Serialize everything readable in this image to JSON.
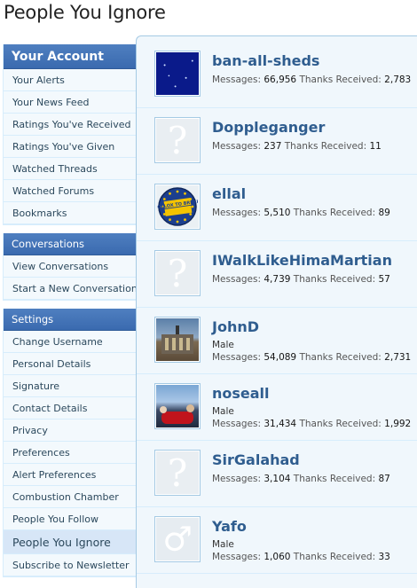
{
  "page": {
    "title": "People You Ignore"
  },
  "sidebar": {
    "sections": [
      {
        "heading": "Your Account",
        "items": [
          "Your Alerts",
          "Your News Feed",
          "Ratings You've Received",
          "Ratings You've Given",
          "Watched Threads",
          "Watched Forums",
          "Bookmarks"
        ]
      },
      {
        "heading": "Conversations",
        "items": [
          "View Conversations",
          "Start a New Conversation"
        ]
      },
      {
        "heading": "Settings",
        "items": [
          "Change Username",
          "Personal Details",
          "Signature",
          "Contact Details",
          "Privacy",
          "Preferences",
          "Alert Preferences",
          "Combustion Chamber",
          "People You Follow",
          "People You Ignore",
          "Subscribe to Newsletter"
        ]
      }
    ],
    "active_item": "People You Ignore"
  },
  "labels": {
    "messages": "Messages:",
    "thanks": "Thanks Received:"
  },
  "members": [
    {
      "username": "ban-all-sheds",
      "user_title": "",
      "messages": "66,956",
      "thanks": "2,783",
      "avatar": "starfield-avatar"
    },
    {
      "username": "Doppleganger",
      "user_title": "",
      "messages": "237",
      "thanks": "11",
      "avatar": "question-placeholder-icon"
    },
    {
      "username": "ellal",
      "user_title": "",
      "messages": "5,510",
      "thanks": "89",
      "avatar": "bollox-to-brexit-badge",
      "badge_text": "BOLLOX TO BREXIT"
    },
    {
      "username": "IWalkLikeHimaMartian",
      "user_title": "",
      "messages": "4,739",
      "thanks": "57",
      "avatar": "question-placeholder-icon"
    },
    {
      "username": "JohnD",
      "user_title": "Male",
      "messages": "54,089",
      "thanks": "2,731",
      "avatar": "building-photo-avatar"
    },
    {
      "username": "noseall",
      "user_title": "Male",
      "messages": "31,434",
      "thanks": "1,992",
      "avatar": "crowd-photo-avatar"
    },
    {
      "username": "SirGalahad",
      "user_title": "",
      "messages": "3,104",
      "thanks": "87",
      "avatar": "question-placeholder-icon"
    },
    {
      "username": "Yafo",
      "user_title": "Male",
      "messages": "1,060",
      "thanks": "33",
      "avatar": "male-symbol-icon"
    }
  ],
  "colors": {
    "accent": "#3a6aaf",
    "username": "#2f5d8f",
    "panel": "#f0f7fc",
    "border": "#a5cae4"
  }
}
